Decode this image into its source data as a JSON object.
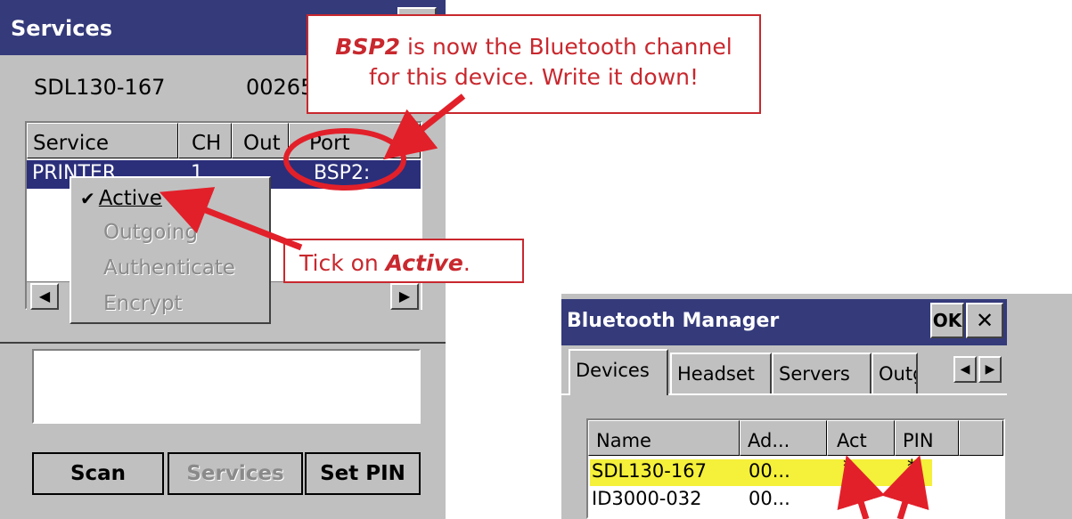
{
  "services_window": {
    "title": "Services",
    "device_name": "SDL130-167",
    "device_address": "00265",
    "columns": [
      "Service",
      "CH",
      "Out",
      "Port"
    ],
    "row": {
      "service": "PRINTER",
      "ch": "1",
      "port": "BSP2:"
    },
    "context_menu": {
      "active": "Active",
      "active_checked": true,
      "outgoing": "Outgoing",
      "authenticate": "Authenticate",
      "encrypt": "Encrypt"
    },
    "buttons": {
      "scan": "Scan",
      "services": "Services",
      "set_pin": "Set PIN"
    }
  },
  "bluetooth_manager": {
    "title": "Bluetooth Manager",
    "ok": "OK",
    "close": "✕",
    "tabs": [
      "Devices",
      "Headset",
      "Servers",
      "Outgoing"
    ],
    "columns": [
      "Name",
      "Ad...",
      "Act",
      "PIN"
    ],
    "rows": [
      {
        "name": "SDL130-167",
        "address": "00...",
        "act": "*",
        "pin": "*",
        "highlighted": true
      },
      {
        "name": "ID3000-032",
        "address": "00...",
        "act": "*",
        "pin": "*"
      }
    ]
  },
  "annotations": {
    "bsp2_prefix": "BSP2",
    "bsp2_line1": " is now the Bluetooth channel",
    "bsp2_line2": "for this device. Write it down!",
    "tick_prefix": "Tick on ",
    "tick_word": "Active",
    "tick_suffix": "."
  },
  "colors": {
    "titlebar": "#343a7a",
    "selection": "#2b2f7a",
    "annotation": "#c8282e",
    "highlight": "#f5f03a"
  }
}
